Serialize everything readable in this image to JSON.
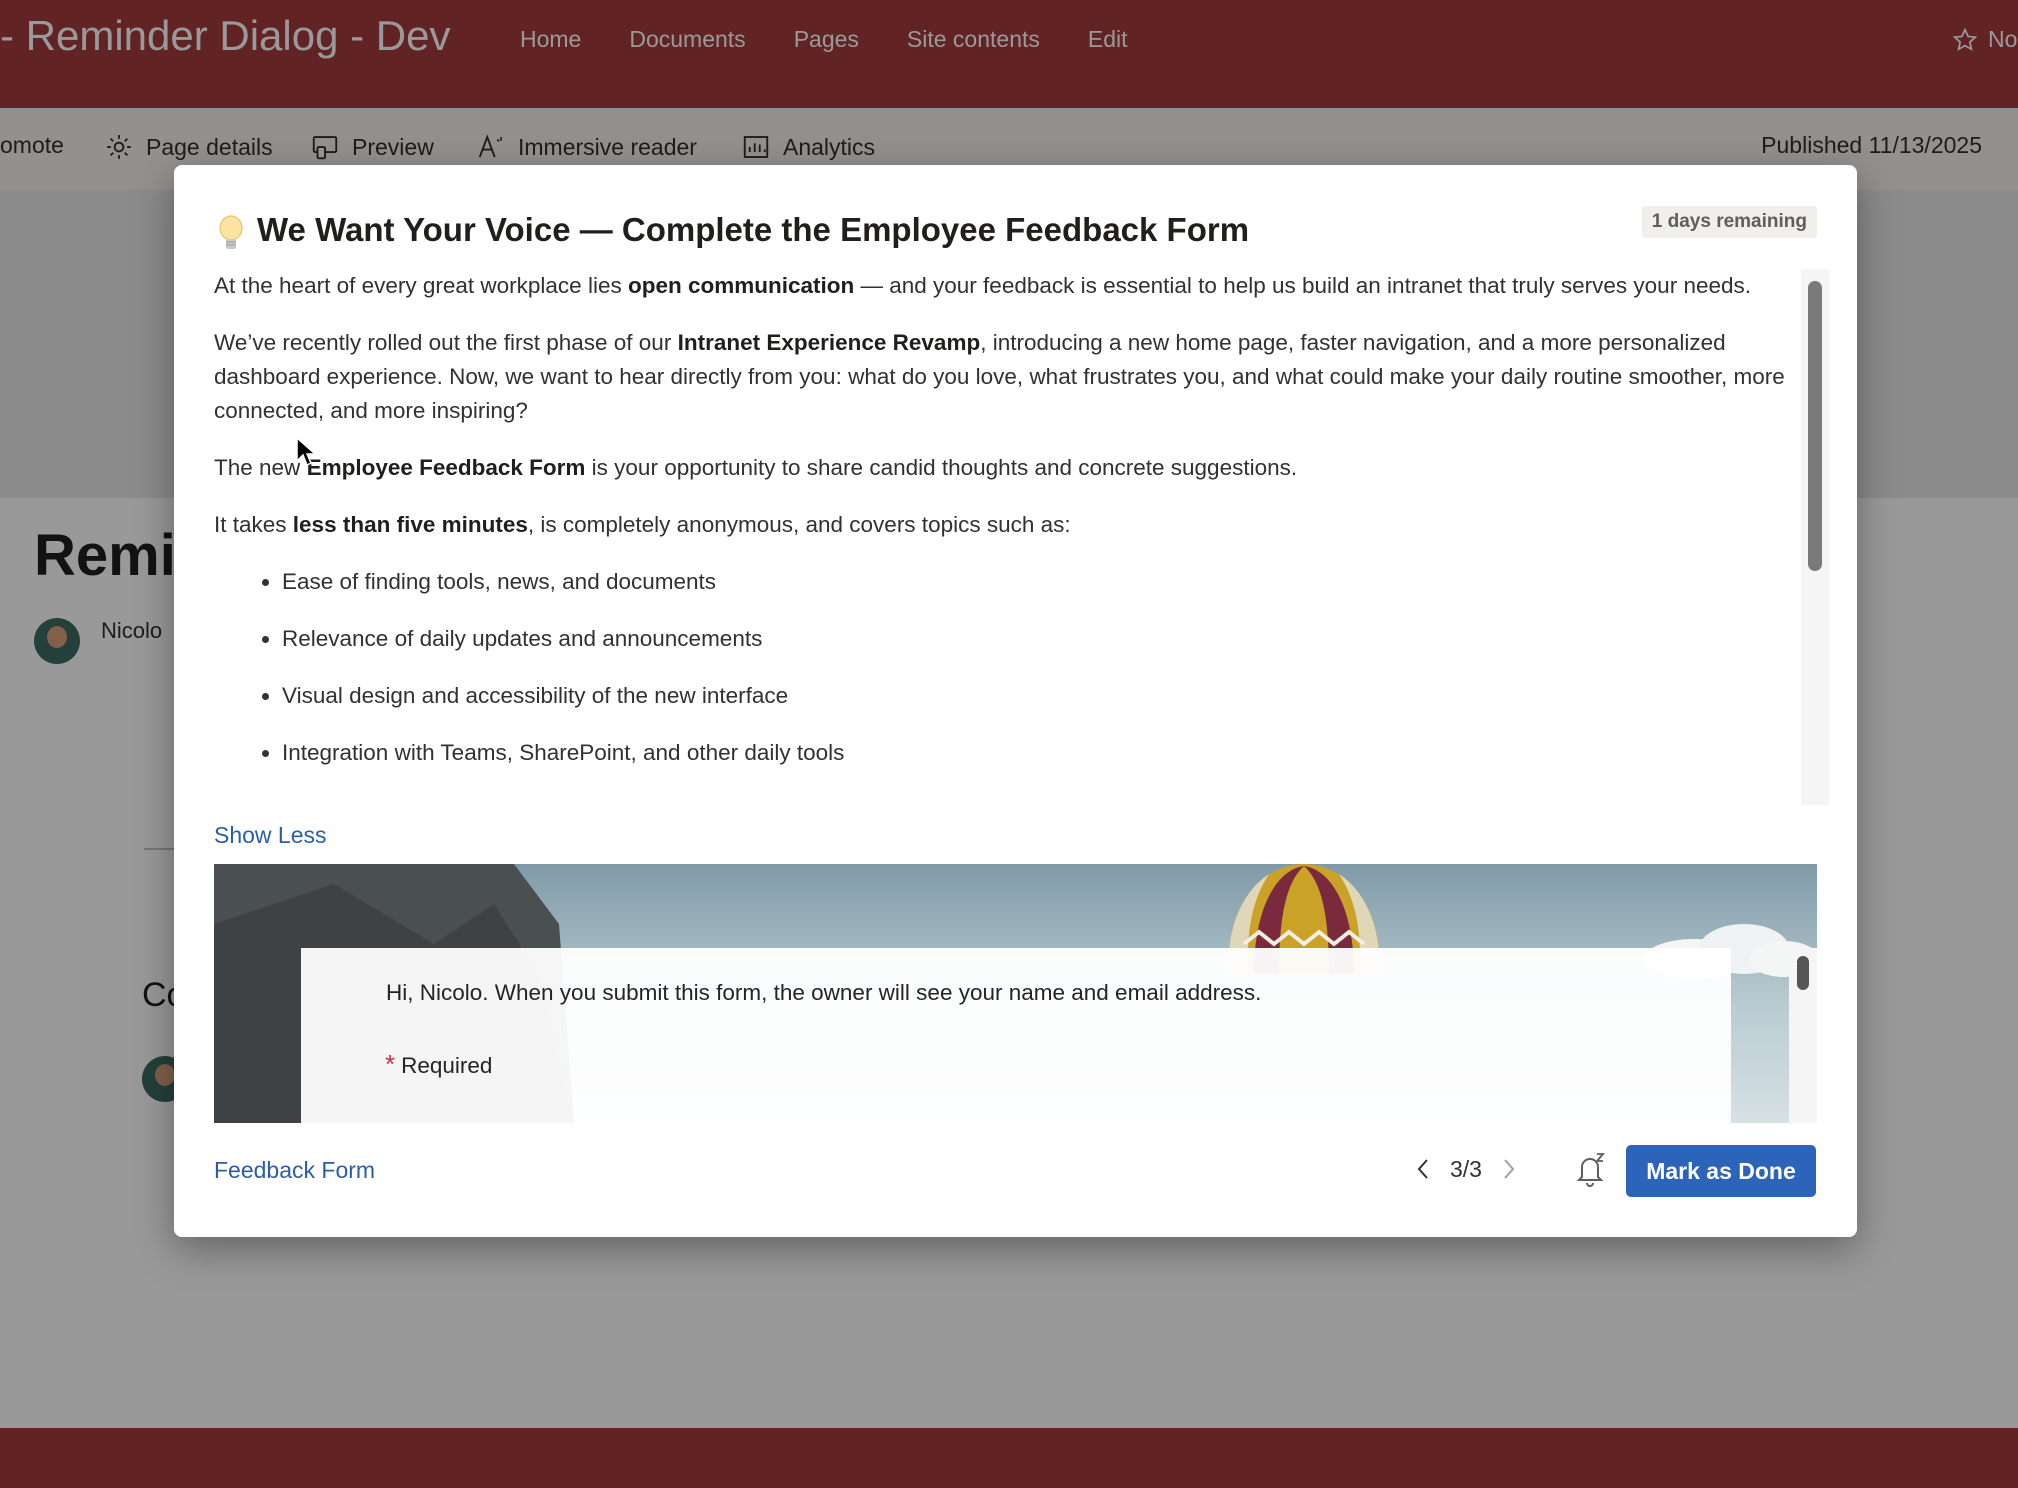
{
  "site": {
    "title": "- Reminder Dialog - Dev",
    "nav": [
      "Home",
      "Documents",
      "Pages",
      "Site contents",
      "Edit"
    ],
    "follow_label": "No"
  },
  "commandbar": {
    "promote_label": "omote",
    "page_details_label": "Page details",
    "preview_label": "Preview",
    "immersive_reader_label": "Immersive reader",
    "analytics_label": "Analytics",
    "published_label": "Published 11/13/2025"
  },
  "page": {
    "title": "Remin",
    "author": "Nicolo",
    "co_label": "Co"
  },
  "dialog": {
    "title": "We Want Your Voice — Complete the Employee Feedback Form",
    "badge": "1 days remaining",
    "body": {
      "p1": {
        "a": "At the heart of every great workplace lies ",
        "b": "open communication",
        "c": " — and your feedback is essential to help us build an intranet that truly serves your needs."
      },
      "p2": {
        "a": "We’ve recently rolled out the first phase of our ",
        "b": "Intranet Experience Revamp",
        "c": ", introducing a new home page, faster navigation, and a more personalized dashboard experience. Now, we want to hear directly from you: what do you love, what frustrates you, and what could make your daily routine smoother, more connected, and more inspiring?"
      },
      "p3": {
        "a": "The new ",
        "b": "Employee Feedback Form",
        "c": " is your opportunity to share candid thoughts and concrete suggestions."
      },
      "p4": {
        "a": "It takes ",
        "b": "less than five minutes",
        "c": ", is completely anonymous, and covers topics such as:"
      },
      "bullets": [
        "Ease of finding tools, news, and documents",
        "Relevance of daily updates and announcements",
        "Visual design and accessibility of the new interface",
        "Integration with Teams, SharePoint, and other daily tools"
      ]
    },
    "show_less_label": "Show Less",
    "form": {
      "notice": "Hi, Nicolo. When you submit this form, the owner will see your name and email address.",
      "required_star": "*",
      "required_label": "Required"
    },
    "link_label": "Feedback Form",
    "pager": "3/3",
    "done_label": "Mark as Done"
  },
  "colors": {
    "suitebar": "#a23b3b",
    "accent": "#2b64b8",
    "link": "#2b5ea7"
  },
  "icons": [
    "star-icon",
    "gear-icon",
    "preview-icon",
    "immersive-reader-icon",
    "analytics-icon",
    "lightbulb-icon",
    "chevron-left-icon",
    "chevron-right-icon",
    "snooze-bell-icon"
  ]
}
